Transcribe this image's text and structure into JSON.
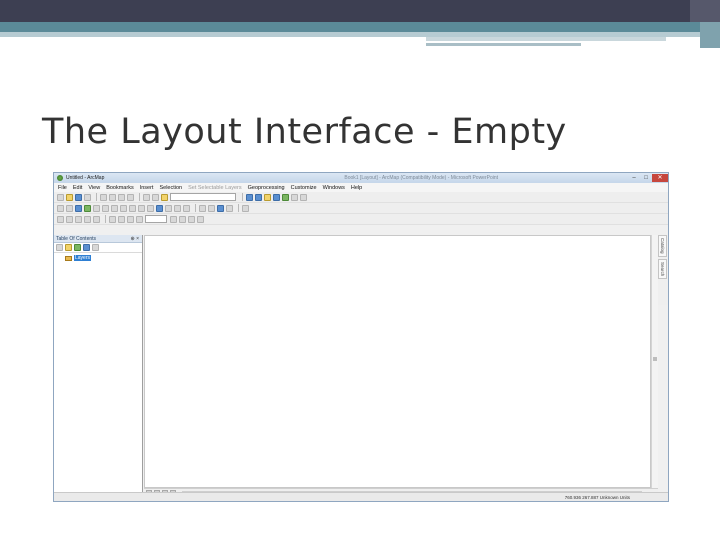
{
  "slide": {
    "title": "The Layout Interface - Empty"
  },
  "window": {
    "title": "Untitled - ArcMap",
    "title_center": "Book1 [Layout] - ArcMap (Compatibility Mode) - Microsoft PowerPoint",
    "minimize": "–",
    "maximize": "□",
    "close": "✕"
  },
  "menu": {
    "items": [
      "File",
      "Edit",
      "View",
      "Bookmarks",
      "Insert",
      "Selection",
      "Set Selectable Layers",
      "Geoprocessing",
      "Customize",
      "Windows",
      "Help"
    ],
    "disabled": [
      6
    ]
  },
  "toc": {
    "title": "Table Of Contents",
    "pin": "⊕ ×",
    "root_label": "Layers"
  },
  "dock": {
    "tabs": [
      "Catalog",
      "Search"
    ]
  },
  "status": {
    "coords": "760.936 267.887 Unknown Units"
  },
  "colors": {
    "title_text": "#333333",
    "header_band": "#3d3f52",
    "accent_teal": "#5b8a98",
    "selection_blue": "#2e7fd3"
  }
}
